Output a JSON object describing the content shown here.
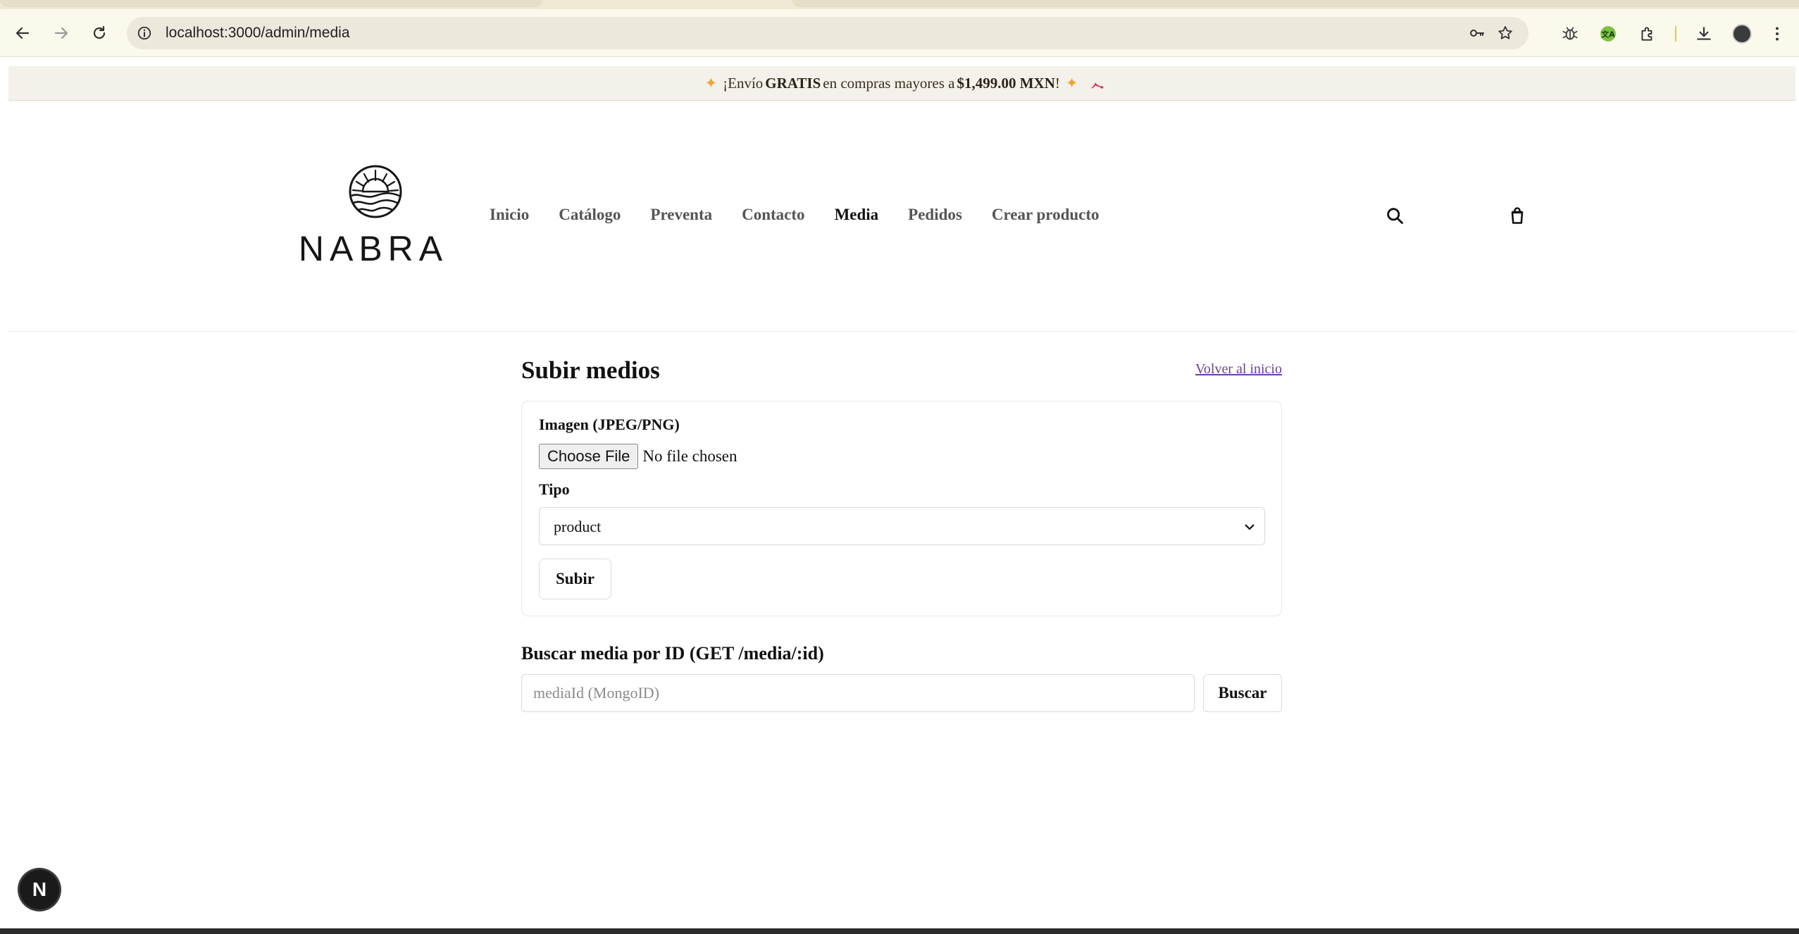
{
  "browser": {
    "url": "localhost:3000/admin/media"
  },
  "announcement": {
    "prefix": "¡Envío ",
    "emphasis": "GRATIS",
    "middle": " en compras mayores a ",
    "amount": "$1,499.00 MXN",
    "suffix": "!",
    "icon_left": "sparkles-icon",
    "icon_right": "high-heel-icon"
  },
  "header": {
    "logo_text": "NABRA",
    "nav": [
      {
        "label": "Inicio",
        "active": false
      },
      {
        "label": "Catálogo",
        "active": false
      },
      {
        "label": "Preventa",
        "active": false
      },
      {
        "label": "Contacto",
        "active": false
      },
      {
        "label": "Media",
        "active": true
      },
      {
        "label": "Pedidos",
        "active": false
      },
      {
        "label": "Crear producto",
        "active": false
      }
    ],
    "icons": [
      "search-icon",
      "shopping-bag-icon"
    ]
  },
  "main": {
    "title": "Subir medios",
    "back_link": "Volver al inicio",
    "upload": {
      "image_label": "Imagen (JPEG/PNG)",
      "file_button": "Choose File",
      "file_status": "No file chosen",
      "type_label": "Tipo",
      "type_value": "product",
      "submit_label": "Subir"
    },
    "search": {
      "title": "Buscar media por ID (GET /media/:id)",
      "placeholder": "mediaId (MongoID)",
      "button": "Buscar"
    }
  },
  "dev": {
    "badge": "N"
  }
}
